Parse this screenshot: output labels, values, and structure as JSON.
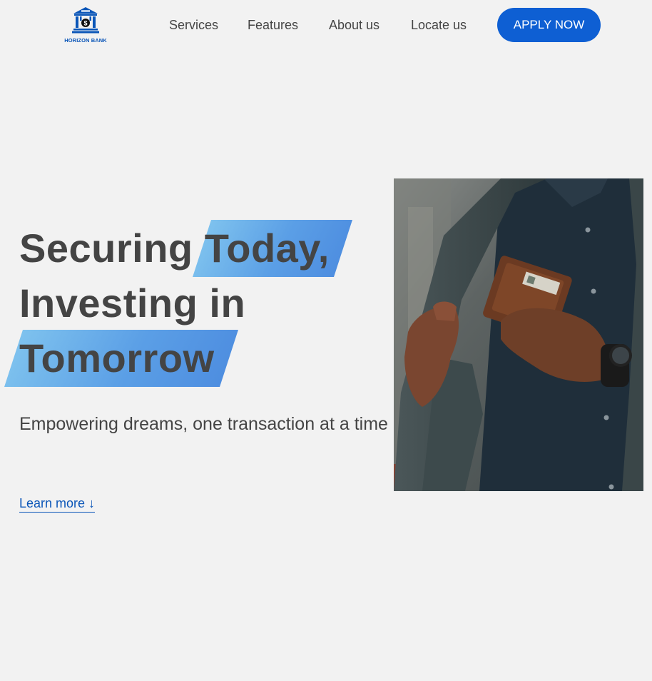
{
  "brand": {
    "name": "HORIZON BANK",
    "logo_icon": "bank-building-icon",
    "color": "#0b56b8"
  },
  "nav": {
    "items": [
      {
        "label": "Services"
      },
      {
        "label": "Features"
      },
      {
        "label": "About us"
      },
      {
        "label": "Locate us"
      }
    ],
    "cta_label": "APPLY NOW",
    "cta_color": "#0e5fd3"
  },
  "hero": {
    "headline": {
      "part1": "Securing",
      "part2": "Today,",
      "part3": "Investing in",
      "part4": "Tomorrow"
    },
    "highlight_colors": [
      "#7ec2ee",
      "#4e8ee0"
    ],
    "subtitle": "Empowering dreams, one transaction at a time",
    "learn_more": "Learn more ↓",
    "image": "man-in-suit-holding-wallet-photo"
  },
  "colors": {
    "background": "#f2f2f2",
    "text": "#444444"
  }
}
